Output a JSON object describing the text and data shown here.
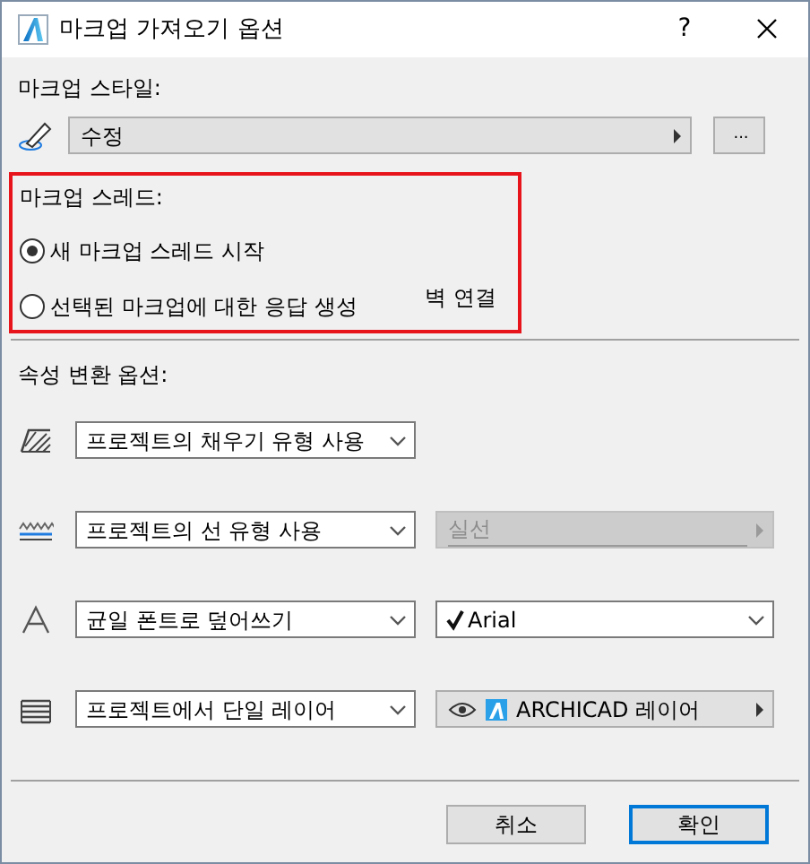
{
  "window": {
    "title": "마크업 가져오기 옵션",
    "help": "?"
  },
  "markup_style": {
    "label": "마크업 스타일:",
    "value": "수정",
    "more_button": "..."
  },
  "markup_thread": {
    "label": "마크업 스레드:",
    "highlighted": true,
    "options": [
      {
        "label": "새 마크업 스레드 시작",
        "selected": true
      },
      {
        "label": "선택된 마크업에 대한 응답 생성",
        "selected": false
      }
    ],
    "note": "벽 연결"
  },
  "attribute_options": {
    "label": "속성 변환 옵션:",
    "rows": [
      {
        "kind": "fill",
        "value": "프로젝트의 채우기 유형 사용"
      },
      {
        "kind": "line",
        "value": "프로젝트의 선 유형 사용",
        "secondary": {
          "kind": "popup",
          "value": "실선",
          "disabled": true
        }
      },
      {
        "kind": "font",
        "value": "균일 폰트로 덮어쓰기",
        "secondary": {
          "kind": "select",
          "value": "Arial",
          "checked": true,
          "disabled": false
        }
      },
      {
        "kind": "layer",
        "value": "프로젝트에서 단일 레이어",
        "secondary": {
          "kind": "layer",
          "value": "ARCHICAD 레이어",
          "visible": true,
          "disabled": false
        }
      }
    ]
  },
  "buttons": [
    {
      "label": "취소",
      "default": false
    },
    {
      "label": "확인",
      "default": true
    }
  ]
}
